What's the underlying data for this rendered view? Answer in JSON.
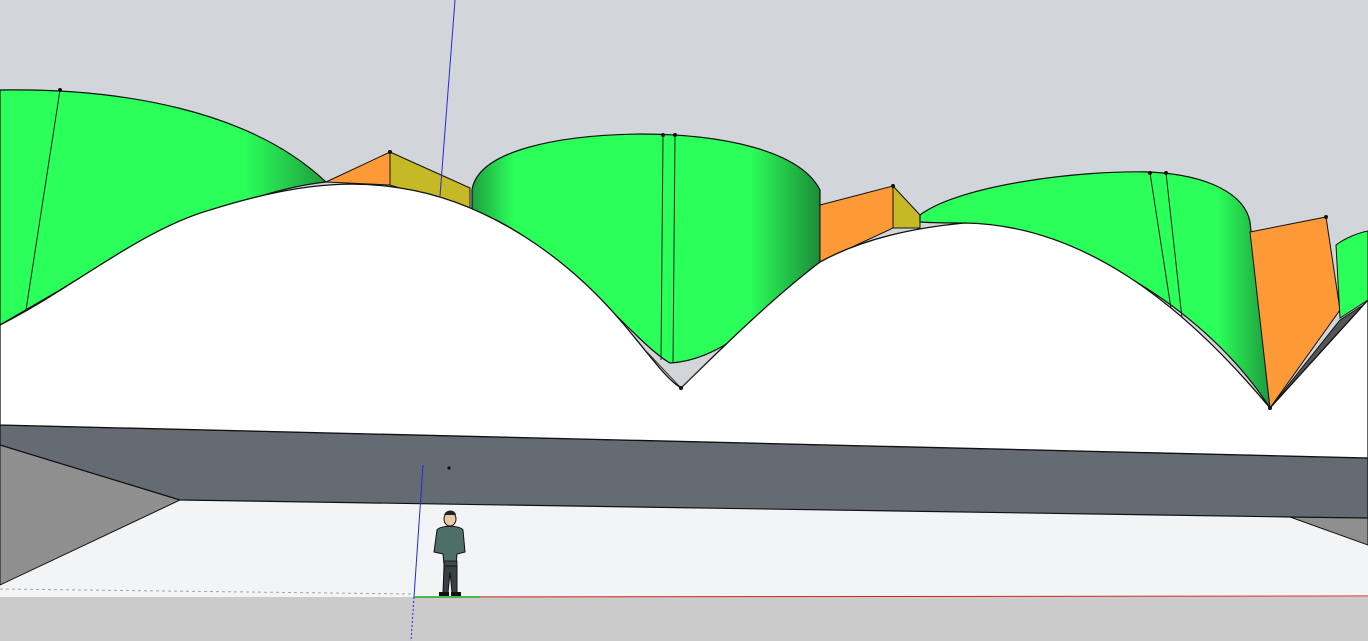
{
  "app": {
    "view": "3d-model-viewport"
  },
  "colors": {
    "sky": "#d2d6da",
    "ground": "#cbcbcb",
    "floor_light": "#f2f4f5",
    "shell_white": "#ffffff",
    "vault_green": "#2bff5a",
    "vault_green_shade": "#1a8a34",
    "gable_orange": "#fd9a37",
    "gable_olive": "#c6b926",
    "slab_front": "#656b72",
    "side_grey": "#8f8f8f",
    "edge_black": "#111111",
    "axis_blue": "#2a2ad6",
    "axis_red": "#cc2222",
    "axis_green": "#22aa22"
  },
  "scene": {
    "objects": [
      "vaulted-roof-shell",
      "green-vault-surfaces",
      "orange-gable-panels",
      "floor-slab",
      "scale-figure",
      "axes"
    ]
  }
}
